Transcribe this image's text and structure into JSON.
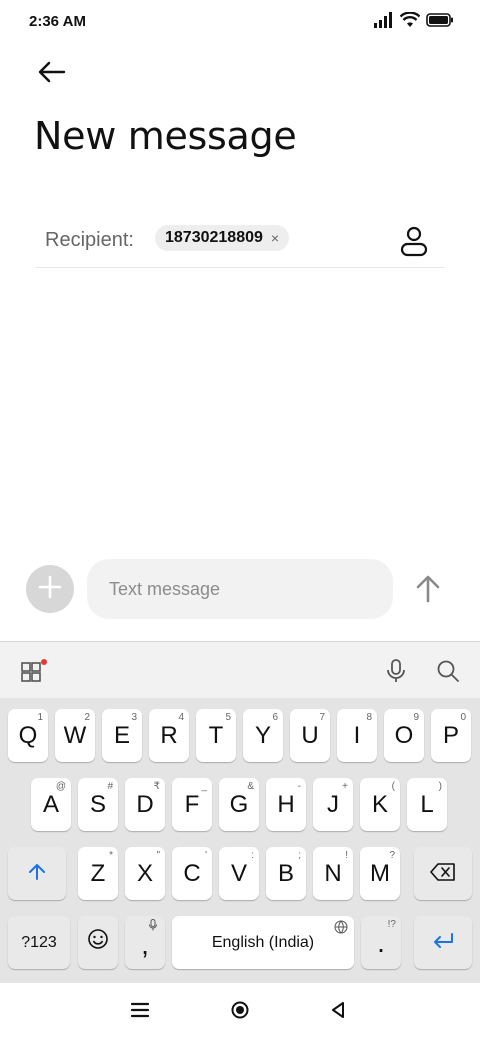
{
  "status": {
    "time": "2:36 AM"
  },
  "header": {
    "title": "New message"
  },
  "recipient": {
    "label": "Recipient:",
    "chip": "18730218809",
    "chip_close": "×"
  },
  "compose": {
    "placeholder": "Text message"
  },
  "keyboard": {
    "row1": [
      {
        "k": "Q",
        "h": "1"
      },
      {
        "k": "W",
        "h": "2"
      },
      {
        "k": "E",
        "h": "3"
      },
      {
        "k": "R",
        "h": "4"
      },
      {
        "k": "T",
        "h": "5"
      },
      {
        "k": "Y",
        "h": "6"
      },
      {
        "k": "U",
        "h": "7"
      },
      {
        "k": "I",
        "h": "8"
      },
      {
        "k": "O",
        "h": "9"
      },
      {
        "k": "P",
        "h": "0"
      }
    ],
    "row2": [
      {
        "k": "A",
        "h": "@"
      },
      {
        "k": "S",
        "h": "#"
      },
      {
        "k": "D",
        "h": "₹"
      },
      {
        "k": "F",
        "h": "_"
      },
      {
        "k": "G",
        "h": "&"
      },
      {
        "k": "H",
        "h": "-"
      },
      {
        "k": "J",
        "h": "+"
      },
      {
        "k": "K",
        "h": "("
      },
      {
        "k": "L",
        "h": ")"
      }
    ],
    "row3": [
      {
        "k": "Z",
        "h": "*"
      },
      {
        "k": "X",
        "h": "\""
      },
      {
        "k": "C",
        "h": "'"
      },
      {
        "k": "V",
        "h": ":"
      },
      {
        "k": "B",
        "h": ";"
      },
      {
        "k": "N",
        "h": "!"
      },
      {
        "k": "M",
        "h": "?"
      }
    ],
    "symbols_label": "?123",
    "comma": ",",
    "space_label": "English (India)",
    "period": ".",
    "period_hint": "!?"
  },
  "colors": {
    "accent": "#1a73e8",
    "badge": "#e53935"
  }
}
